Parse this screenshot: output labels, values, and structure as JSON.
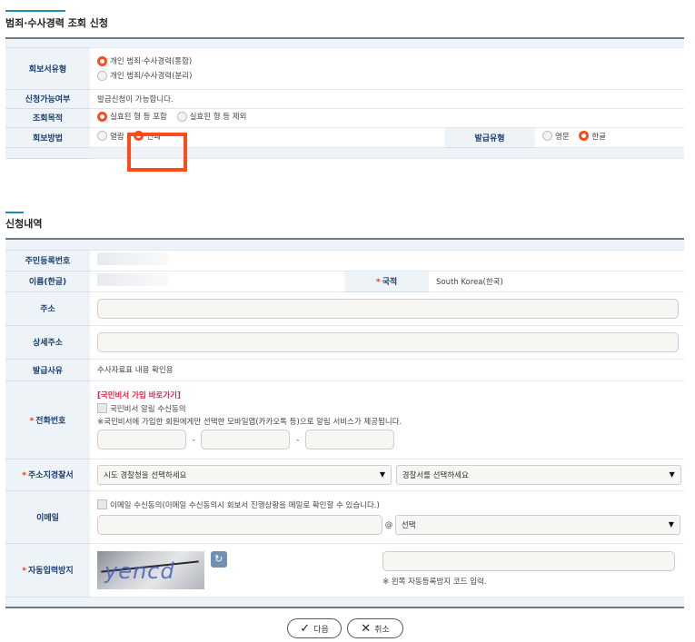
{
  "section1": {
    "title": "범죄·수사경력 조회 신청",
    "rows": {
      "report_type": {
        "label": "회보서유형",
        "options": [
          "개인 범죄·수사경력(통합)",
          "개인 범죄/수사경력(분리)"
        ],
        "selected": 0
      },
      "availability": {
        "label": "신청가능여부",
        "value": "발급신청이 가능합니다."
      },
      "purpose": {
        "label": "조회목적",
        "options": [
          "실효된 형 등 포함",
          "실효된 형 등 제외"
        ],
        "selected": 0
      },
      "method": {
        "label": "회보방법",
        "options": [
          "열람",
          "인쇄"
        ],
        "selected": 1
      },
      "issue_type": {
        "label": "발급유형",
        "options": [
          "영문",
          "한글"
        ],
        "selected": 1
      }
    }
  },
  "section2": {
    "title": "신청내역",
    "rows": {
      "rrn": {
        "label": "주민등록번호"
      },
      "name": {
        "label": "이름(한글)"
      },
      "nationality": {
        "label": "국적",
        "value": "South Korea(한국)"
      },
      "address": {
        "label": "주소"
      },
      "detail_address": {
        "label": "상세주소"
      },
      "reason": {
        "label": "발급사유",
        "value": "수사자료표 내용 확인용"
      },
      "phone": {
        "label": "전화번호",
        "join_link": "[국민비서 가입 바로가기]",
        "consent": "국민비서 알림 수신동의",
        "note": "※국민비서에 가입한 회원에게만 선택한 모바일앱(카카오톡 등)으로 알림 서비스가 제공됩니다.",
        "separator": "-"
      },
      "police": {
        "label": "주소지경찰서",
        "select1": "시도 경찰청을 선택하세요",
        "select2": "경찰서를 선택하세요"
      },
      "email": {
        "label": "이메일",
        "consent": "이메일 수신동의(이메일 수신동의시 회보서 진행상황을 메일로 확인할 수 있습니다.)",
        "at": "@",
        "domain_select": "선택"
      },
      "captcha": {
        "label": "자동입력방지",
        "image_text": "yencd",
        "hint": "※ 왼쪽 자동등록방지 코드 입력."
      }
    }
  },
  "required_mark": "*",
  "buttons": {
    "next": "다음",
    "cancel": "취소"
  },
  "icons": {
    "next": "check-icon",
    "cancel": "x-icon",
    "refresh": "refresh-icon",
    "dropdown": "caret-down-icon"
  },
  "colors": {
    "accent": "#1a8fb8",
    "label_bg": "#eef3f8",
    "label_text": "#1a3d6d",
    "radio_on": "#ff4a1c",
    "highlight": "#ff4a1c",
    "required": "#e8371b",
    "link_red": "#e0224d",
    "status_blue": "#2a56c6"
  }
}
